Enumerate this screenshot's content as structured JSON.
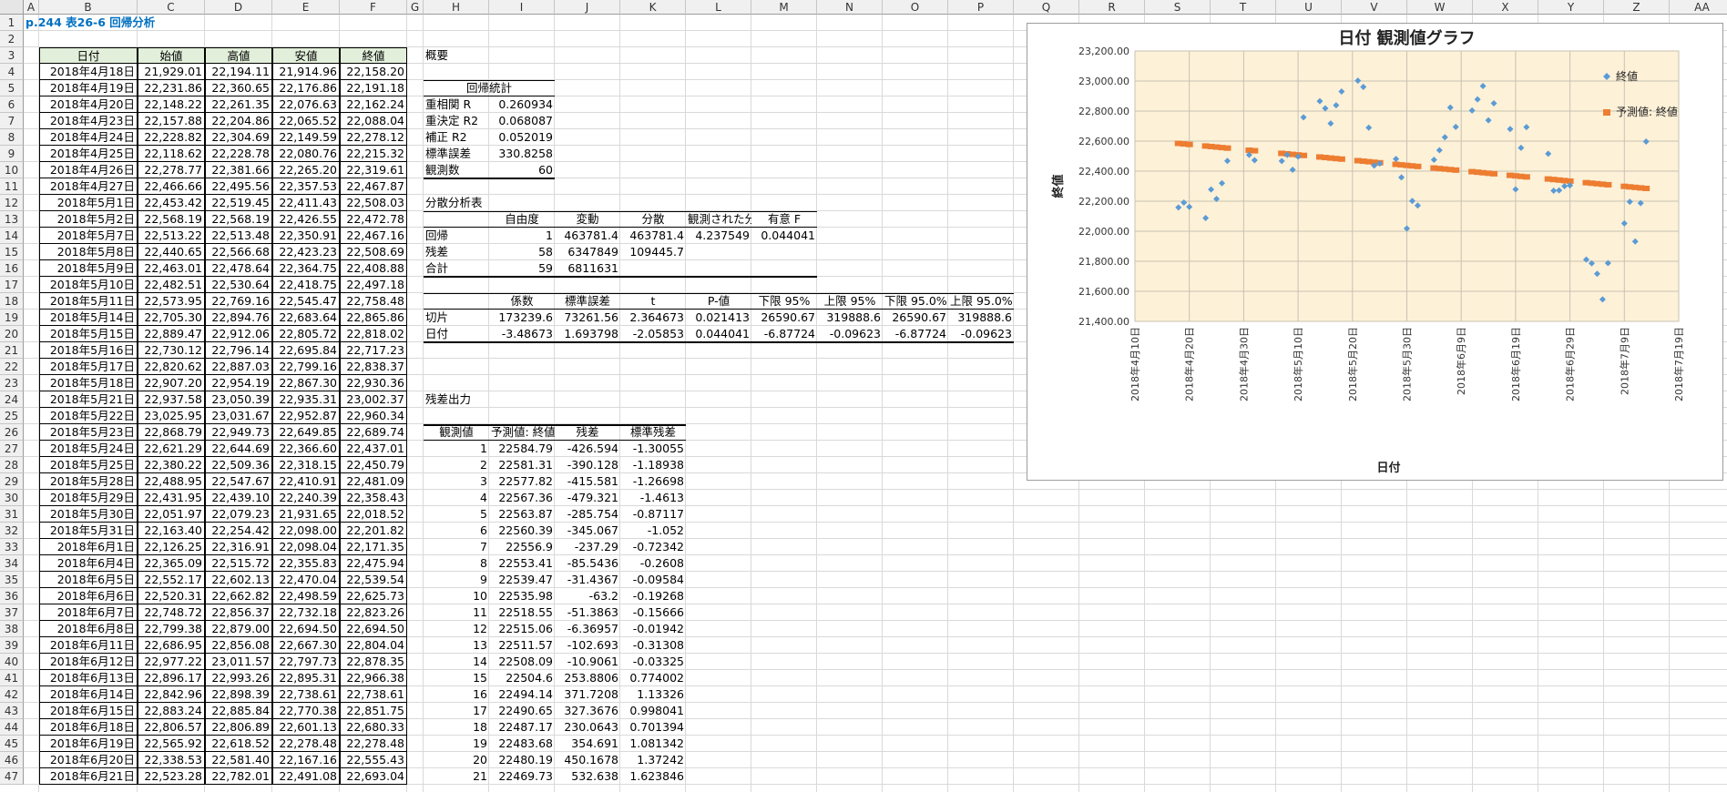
{
  "sheet_title": "p.244 表26-6 回帰分析",
  "columns": [
    "A",
    "B",
    "C",
    "D",
    "E",
    "F",
    "G",
    "H",
    "I",
    "J",
    "K",
    "L",
    "M",
    "N",
    "O",
    "P",
    "Q",
    "R",
    "S",
    "T",
    "U",
    "V",
    "W",
    "X",
    "Y",
    "Z",
    "AA"
  ],
  "rows": [
    "1",
    "2",
    "3",
    "4",
    "5",
    "6",
    "7",
    "8",
    "9",
    "10",
    "11",
    "12",
    "13",
    "14",
    "15",
    "16",
    "17",
    "18",
    "19",
    "20",
    "21",
    "22",
    "23",
    "24",
    "25",
    "26",
    "27",
    "28",
    "29",
    "30",
    "31",
    "32",
    "33",
    "34",
    "35",
    "36",
    "37",
    "38",
    "39",
    "40",
    "41",
    "42",
    "43",
    "44",
    "45",
    "46",
    "47"
  ],
  "price_table": {
    "headers": [
      "日付",
      "始値",
      "高値",
      "安値",
      "終値"
    ],
    "rows": [
      [
        "2018年4月18日",
        "21,929.01",
        "22,194.11",
        "21,914.96",
        "22,158.20"
      ],
      [
        "2018年4月19日",
        "22,231.86",
        "22,360.65",
        "22,176.86",
        "22,191.18"
      ],
      [
        "2018年4月20日",
        "22,148.22",
        "22,261.35",
        "22,076.63",
        "22,162.24"
      ],
      [
        "2018年4月23日",
        "22,157.88",
        "22,204.86",
        "22,065.52",
        "22,088.04"
      ],
      [
        "2018年4月24日",
        "22,228.82",
        "22,304.69",
        "22,149.59",
        "22,278.12"
      ],
      [
        "2018年4月25日",
        "22,118.62",
        "22,228.78",
        "22,080.76",
        "22,215.32"
      ],
      [
        "2018年4月26日",
        "22,278.77",
        "22,381.66",
        "22,265.20",
        "22,319.61"
      ],
      [
        "2018年4月27日",
        "22,466.66",
        "22,495.56",
        "22,357.53",
        "22,467.87"
      ],
      [
        "2018年5月1日",
        "22,453.42",
        "22,519.45",
        "22,411.43",
        "22,508.03"
      ],
      [
        "2018年5月2日",
        "22,568.19",
        "22,568.19",
        "22,426.55",
        "22,472.78"
      ],
      [
        "2018年5月7日",
        "22,513.22",
        "22,513.48",
        "22,350.91",
        "22,467.16"
      ],
      [
        "2018年5月8日",
        "22,440.65",
        "22,566.68",
        "22,423.23",
        "22,508.69"
      ],
      [
        "2018年5月9日",
        "22,463.01",
        "22,478.64",
        "22,364.75",
        "22,408.88"
      ],
      [
        "2018年5月10日",
        "22,482.51",
        "22,530.64",
        "22,418.75",
        "22,497.18"
      ],
      [
        "2018年5月11日",
        "22,573.95",
        "22,769.16",
        "22,545.47",
        "22,758.48"
      ],
      [
        "2018年5月14日",
        "22,705.30",
        "22,894.76",
        "22,683.64",
        "22,865.86"
      ],
      [
        "2018年5月15日",
        "22,889.47",
        "22,912.06",
        "22,805.72",
        "22,818.02"
      ],
      [
        "2018年5月16日",
        "22,730.12",
        "22,796.14",
        "22,695.84",
        "22,717.23"
      ],
      [
        "2018年5月17日",
        "22,820.62",
        "22,887.03",
        "22,799.16",
        "22,838.37"
      ],
      [
        "2018年5月18日",
        "22,907.20",
        "22,954.19",
        "22,867.30",
        "22,930.36"
      ],
      [
        "2018年5月21日",
        "22,937.58",
        "23,050.39",
        "22,935.31",
        "23,002.37"
      ],
      [
        "2018年5月22日",
        "23,025.95",
        "23,031.67",
        "22,952.87",
        "22,960.34"
      ],
      [
        "2018年5月23日",
        "22,868.79",
        "22,949.73",
        "22,649.85",
        "22,689.74"
      ],
      [
        "2018年5月24日",
        "22,621.29",
        "22,644.69",
        "22,366.60",
        "22,437.01"
      ],
      [
        "2018年5月25日",
        "22,380.22",
        "22,509.36",
        "22,318.15",
        "22,450.79"
      ],
      [
        "2018年5月28日",
        "22,488.95",
        "22,547.67",
        "22,410.91",
        "22,481.09"
      ],
      [
        "2018年5月29日",
        "22,431.95",
        "22,439.10",
        "22,240.39",
        "22,358.43"
      ],
      [
        "2018年5月30日",
        "22,051.97",
        "22,079.23",
        "21,931.65",
        "22,018.52"
      ],
      [
        "2018年5月31日",
        "22,163.40",
        "22,254.42",
        "22,098.00",
        "22,201.82"
      ],
      [
        "2018年6月1日",
        "22,126.25",
        "22,316.91",
        "22,098.04",
        "22,171.35"
      ],
      [
        "2018年6月4日",
        "22,365.09",
        "22,515.72",
        "22,355.83",
        "22,475.94"
      ],
      [
        "2018年6月5日",
        "22,552.17",
        "22,602.13",
        "22,470.04",
        "22,539.54"
      ],
      [
        "2018年6月6日",
        "22,520.31",
        "22,662.82",
        "22,498.59",
        "22,625.73"
      ],
      [
        "2018年6月7日",
        "22,748.72",
        "22,856.37",
        "22,732.18",
        "22,823.26"
      ],
      [
        "2018年6月8日",
        "22,799.38",
        "22,879.00",
        "22,694.50",
        "22,694.50"
      ],
      [
        "2018年6月11日",
        "22,686.95",
        "22,856.08",
        "22,667.30",
        "22,804.04"
      ],
      [
        "2018年6月12日",
        "22,977.22",
        "23,011.57",
        "22,797.73",
        "22,878.35"
      ],
      [
        "2018年6月13日",
        "22,896.17",
        "22,993.26",
        "22,895.31",
        "22,966.38"
      ],
      [
        "2018年6月14日",
        "22,842.96",
        "22,898.39",
        "22,738.61",
        "22,738.61"
      ],
      [
        "2018年6月15日",
        "22,883.24",
        "22,885.84",
        "22,770.38",
        "22,851.75"
      ],
      [
        "2018年6月18日",
        "22,806.57",
        "22,806.89",
        "22,601.13",
        "22,680.33"
      ],
      [
        "2018年6月19日",
        "22,565.92",
        "22,618.52",
        "22,278.48",
        "22,278.48"
      ],
      [
        "2018年6月20日",
        "22,338.53",
        "22,581.40",
        "22,167.16",
        "22,555.43"
      ],
      [
        "2018年6月21日",
        "22,523.28",
        "22,782.01",
        "22,491.08",
        "22,693.04"
      ]
    ]
  },
  "summary": {
    "label": "概要",
    "reg_stats_header": "回帰統計",
    "reg_stats": [
      [
        "重相関 R",
        "0.260934"
      ],
      [
        "重決定 R2",
        "0.068087"
      ],
      [
        "補正 R2",
        "0.052019"
      ],
      [
        "標準誤差",
        "330.8258"
      ],
      [
        "観測数",
        "60"
      ]
    ],
    "anova_label": "分散分析表",
    "anova_headers": [
      "",
      "自由度",
      "変動",
      "分散",
      "観測された分散比",
      "有意 F"
    ],
    "anova_rows": [
      [
        "回帰",
        "1",
        "463781.4",
        "463781.4",
        "4.237549",
        "0.044041"
      ],
      [
        "残差",
        "58",
        "6347849",
        "109445.7",
        "",
        ""
      ],
      [
        "合計",
        "59",
        "6811631",
        "",
        "",
        ""
      ]
    ],
    "coef_headers": [
      "",
      "係数",
      "標準誤差",
      "t",
      "P-値",
      "下限 95%",
      "上限 95%",
      "下限 95.0%",
      "上限 95.0%"
    ],
    "coef_rows": [
      [
        "切片",
        "173239.6",
        "73261.56",
        "2.364673",
        "0.021413",
        "26590.67",
        "319888.6",
        "26590.67",
        "319888.6"
      ],
      [
        "日付",
        "-3.48673",
        "1.693798",
        "-2.05853",
        "0.044041",
        "-6.87724",
        "-0.09623",
        "-6.87724",
        "-0.09623"
      ]
    ],
    "resid_label": "残差出力",
    "resid_headers": [
      "観測値",
      "予測値: 終値",
      "残差",
      "標準残差"
    ],
    "resid_rows": [
      [
        "1",
        "22584.79",
        "-426.594",
        "-1.30055"
      ],
      [
        "2",
        "22581.31",
        "-390.128",
        "-1.18938"
      ],
      [
        "3",
        "22577.82",
        "-415.581",
        "-1.26698"
      ],
      [
        "4",
        "22567.36",
        "-479.321",
        "-1.4613"
      ],
      [
        "5",
        "22563.87",
        "-285.754",
        "-0.87117"
      ],
      [
        "6",
        "22560.39",
        "-345.067",
        "-1.052"
      ],
      [
        "7",
        "22556.9",
        "-237.29",
        "-0.72342"
      ],
      [
        "8",
        "22553.41",
        "-85.5436",
        "-0.2608"
      ],
      [
        "9",
        "22539.47",
        "-31.4367",
        "-0.09584"
      ],
      [
        "10",
        "22535.98",
        "-63.2",
        "-0.19268"
      ],
      [
        "11",
        "22518.55",
        "-51.3863",
        "-0.15666"
      ],
      [
        "12",
        "22515.06",
        "-6.36957",
        "-0.01942"
      ],
      [
        "13",
        "22511.57",
        "-102.693",
        "-0.31308"
      ],
      [
        "14",
        "22508.09",
        "-10.9061",
        "-0.03325"
      ],
      [
        "15",
        "22504.6",
        "253.8806",
        "0.774002"
      ],
      [
        "16",
        "22494.14",
        "371.7208",
        "1.13326"
      ],
      [
        "17",
        "22490.65",
        "327.3676",
        "0.998041"
      ],
      [
        "18",
        "22487.17",
        "230.0643",
        "0.701394"
      ],
      [
        "19",
        "22483.68",
        "354.691",
        "1.081342"
      ],
      [
        "20",
        "22480.19",
        "450.1678",
        "1.37242"
      ],
      [
        "21",
        "22469.73",
        "532.638",
        "1.623846"
      ]
    ]
  },
  "chart_data": {
    "type": "scatter",
    "title": "日付 観測値グラフ",
    "xlabel": "日付",
    "ylabel": "終値",
    "ylim": [
      21400,
      23200
    ],
    "y_ticks": [
      "21,400.00",
      "21,600.00",
      "21,800.00",
      "22,000.00",
      "22,200.00",
      "22,400.00",
      "22,600.00",
      "22,800.00",
      "23,000.00",
      "23,200.00"
    ],
    "x_tick_labels": [
      "2018年4月10日",
      "2018年4月20日",
      "2018年4月30日",
      "2018年5月10日",
      "2018年5月20日",
      "2018年5月30日",
      "2018年6月9日",
      "2018年6月19日",
      "2018年6月29日",
      "2018年7月9日",
      "2018年7月19日"
    ],
    "grid": true,
    "legend_position": "top-right",
    "colors": {
      "observed": "#5b9bd5",
      "predicted": "#ed7d31",
      "plot_bg": "#fdf1d8"
    },
    "series": [
      {
        "name": "終値",
        "marker": "diamond",
        "x": [
          "2018-04-18",
          "2018-04-19",
          "2018-04-20",
          "2018-04-23",
          "2018-04-24",
          "2018-04-25",
          "2018-04-26",
          "2018-04-27",
          "2018-05-01",
          "2018-05-02",
          "2018-05-07",
          "2018-05-08",
          "2018-05-09",
          "2018-05-10",
          "2018-05-11",
          "2018-05-14",
          "2018-05-15",
          "2018-05-16",
          "2018-05-17",
          "2018-05-18",
          "2018-05-21",
          "2018-05-22",
          "2018-05-23",
          "2018-05-24",
          "2018-05-25",
          "2018-05-28",
          "2018-05-29",
          "2018-05-30",
          "2018-05-31",
          "2018-06-01",
          "2018-06-04",
          "2018-06-05",
          "2018-06-06",
          "2018-06-07",
          "2018-06-08",
          "2018-06-11",
          "2018-06-12",
          "2018-06-13",
          "2018-06-14",
          "2018-06-15",
          "2018-06-18",
          "2018-06-19",
          "2018-06-20",
          "2018-06-21",
          "2018-06-25",
          "2018-06-26",
          "2018-06-27",
          "2018-06-28",
          "2018-06-29",
          "2018-07-02",
          "2018-07-03",
          "2018-07-04",
          "2018-07-05",
          "2018-07-06",
          "2018-07-09",
          "2018-07-10",
          "2018-07-11",
          "2018-07-12",
          "2018-07-13"
        ],
        "y": [
          22158.2,
          22191.18,
          22162.24,
          22088.04,
          22278.12,
          22215.32,
          22319.61,
          22467.87,
          22508.03,
          22472.78,
          22467.16,
          22508.69,
          22408.88,
          22497.18,
          22758.48,
          22865.86,
          22818.02,
          22717.23,
          22838.37,
          22930.36,
          23002.37,
          22960.34,
          22689.74,
          22437.01,
          22450.79,
          22481.09,
          22358.43,
          22018.52,
          22201.82,
          22171.35,
          22475.94,
          22539.54,
          22625.73,
          22823.26,
          22694.5,
          22804.04,
          22878.35,
          22966.38,
          22738.61,
          22851.75,
          22680.33,
          22278.48,
          22555.43,
          22693.04,
          22516.0,
          22270.0,
          22272.0,
          22300.0,
          22305.0,
          21811.0,
          21786.0,
          21717.0,
          21546.0,
          21788.0,
          22052.0,
          22196.0,
          21932.0,
          22187.0,
          22597.0
        ]
      },
      {
        "name": "予測値: 終値",
        "marker": "square",
        "x": [
          "2018-04-18",
          "2018-04-19",
          "2018-04-20",
          "2018-04-23",
          "2018-04-24",
          "2018-04-25",
          "2018-04-26",
          "2018-04-27",
          "2018-05-01",
          "2018-05-02",
          "2018-05-07",
          "2018-05-08",
          "2018-05-09",
          "2018-05-10",
          "2018-05-11",
          "2018-05-14",
          "2018-05-15",
          "2018-05-16",
          "2018-05-17",
          "2018-05-18",
          "2018-05-21",
          "2018-05-22",
          "2018-05-23",
          "2018-05-24",
          "2018-05-25",
          "2018-05-28",
          "2018-05-29",
          "2018-05-30",
          "2018-05-31",
          "2018-06-01",
          "2018-06-04",
          "2018-06-05",
          "2018-06-06",
          "2018-06-07",
          "2018-06-08",
          "2018-06-11",
          "2018-06-12",
          "2018-06-13",
          "2018-06-14",
          "2018-06-15",
          "2018-06-18",
          "2018-06-19",
          "2018-06-20",
          "2018-06-21",
          "2018-06-25",
          "2018-06-26",
          "2018-06-27",
          "2018-06-28",
          "2018-06-29",
          "2018-07-02",
          "2018-07-03",
          "2018-07-04",
          "2018-07-05",
          "2018-07-06",
          "2018-07-09",
          "2018-07-10",
          "2018-07-11",
          "2018-07-12",
          "2018-07-13"
        ],
        "y": [
          22584.79,
          22581.31,
          22577.82,
          22567.36,
          22563.87,
          22560.39,
          22556.9,
          22553.41,
          22539.47,
          22535.98,
          22518.55,
          22515.06,
          22511.57,
          22508.09,
          22504.6,
          22494.14,
          22490.65,
          22487.17,
          22483.68,
          22480.19,
          22469.73,
          22466.24,
          22462.76,
          22459.27,
          22455.79,
          22445.33,
          22441.84,
          22438.35,
          22434.87,
          22431.38,
          22420.92,
          22417.43,
          22413.95,
          22410.46,
          22406.97,
          22396.51,
          22393.03,
          22389.54,
          22386.05,
          22382.57,
          22372.11,
          22368.62,
          22365.13,
          22361.65,
          22347.7,
          22344.21,
          22340.73,
          22337.24,
          22333.75,
          22323.29,
          22319.81,
          22316.32,
          22312.84,
          22309.35,
          22298.89,
          22295.4,
          22291.91,
          22288.43,
          22284.94
        ]
      }
    ]
  }
}
